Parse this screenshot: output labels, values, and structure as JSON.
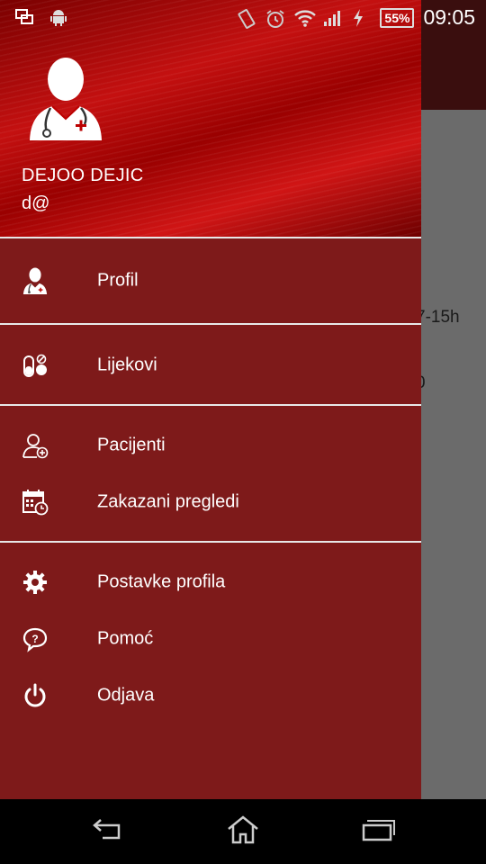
{
  "status_bar": {
    "battery": "55%",
    "time": "09:05",
    "icons": [
      "screen-share-icon",
      "android-icon",
      "vibrate-icon",
      "alarm-icon",
      "wifi-icon",
      "signal-icon",
      "charging-icon"
    ]
  },
  "background": {
    "text1": "7-15h",
    "text2": "0"
  },
  "drawer": {
    "user_name": "DEJOO DEJIC",
    "user_email": "d@",
    "items": [
      {
        "label": "Profil",
        "icon": "doctor-icon"
      },
      {
        "label": "Lijekovi",
        "icon": "pills-icon"
      },
      {
        "label": "Pacijenti",
        "icon": "add-person-icon"
      },
      {
        "label": "Zakazani pregledi",
        "icon": "calendar-clock-icon"
      },
      {
        "label": "Postavke profila",
        "icon": "gear-icon"
      },
      {
        "label": "Pomoć",
        "icon": "help-bubble-icon"
      },
      {
        "label": "Odjava",
        "icon": "power-icon"
      }
    ]
  },
  "colors": {
    "drawer_bg": "#7e1a1a",
    "header_red": "#c41010",
    "divider": "#e8e8e8"
  },
  "nav_bar": {
    "buttons": [
      "back-icon",
      "home-icon",
      "recents-icon"
    ]
  }
}
